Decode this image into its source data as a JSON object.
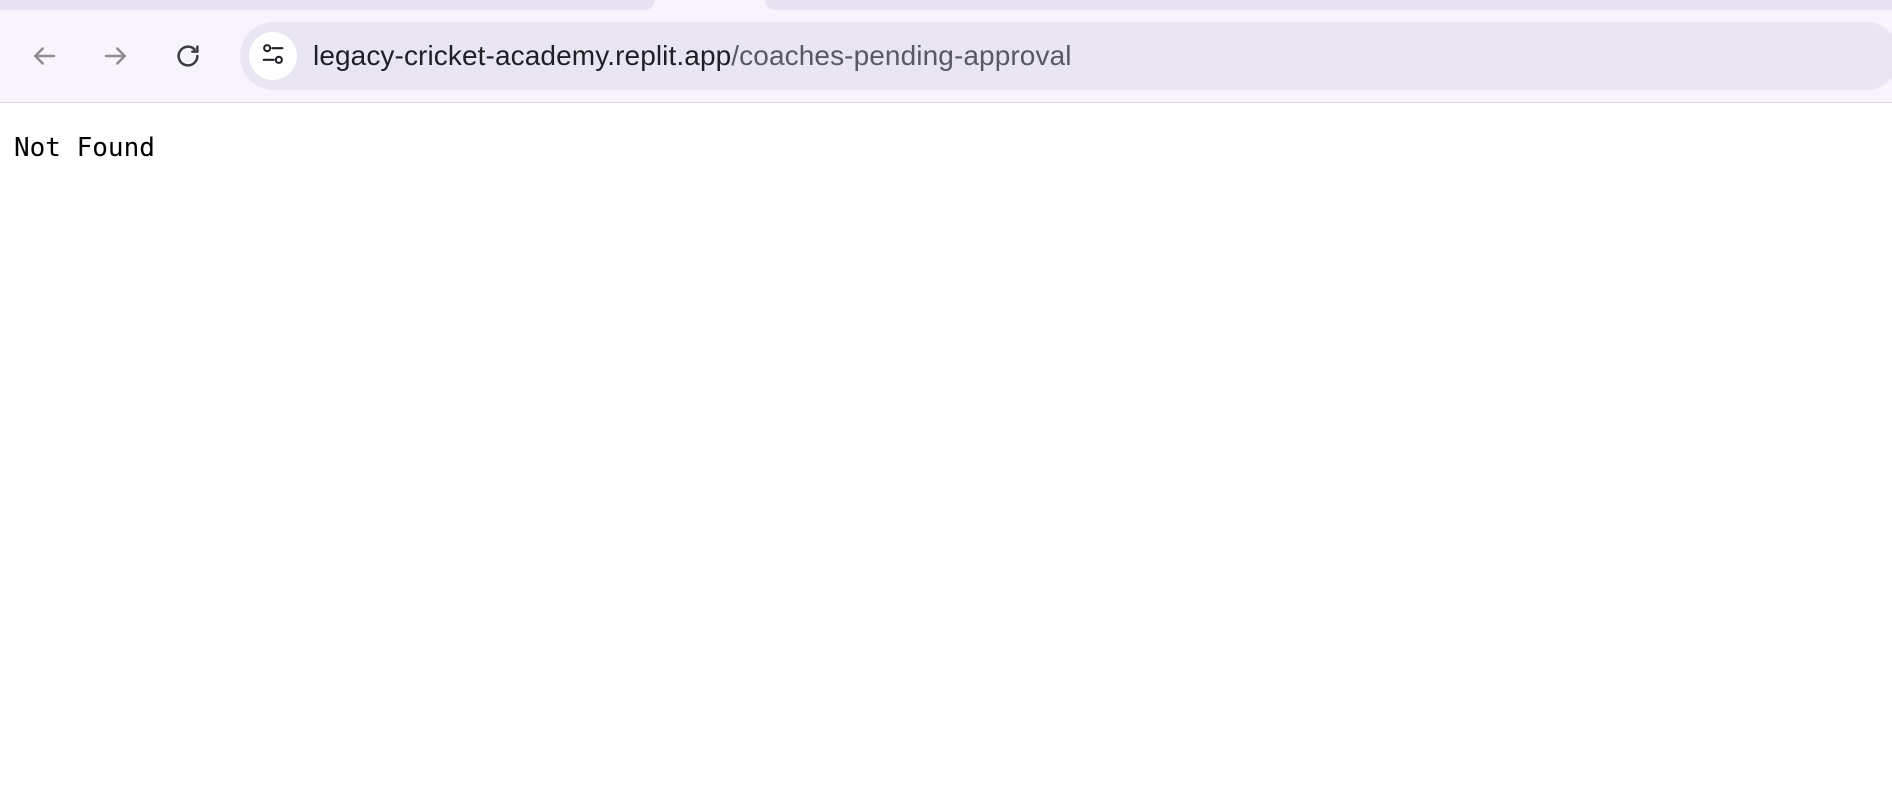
{
  "browser": {
    "toolbar": {
      "back_icon": "arrow-left-icon",
      "forward_icon": "arrow-right-icon",
      "reload_icon": "reload-icon",
      "site_info_icon": "tune-icon"
    },
    "address_bar": {
      "host": "legacy-cricket-academy.replit.app",
      "path": "/coaches-pending-approval"
    }
  },
  "page": {
    "body_text": "Not Found"
  },
  "colors": {
    "chrome_bg": "#f8f4fc",
    "omnibox_bg": "#e9e5f2",
    "tab_bg": "#e8e3f2",
    "icon_disabled": "#8f8c96",
    "icon_active": "#3c3a42"
  }
}
